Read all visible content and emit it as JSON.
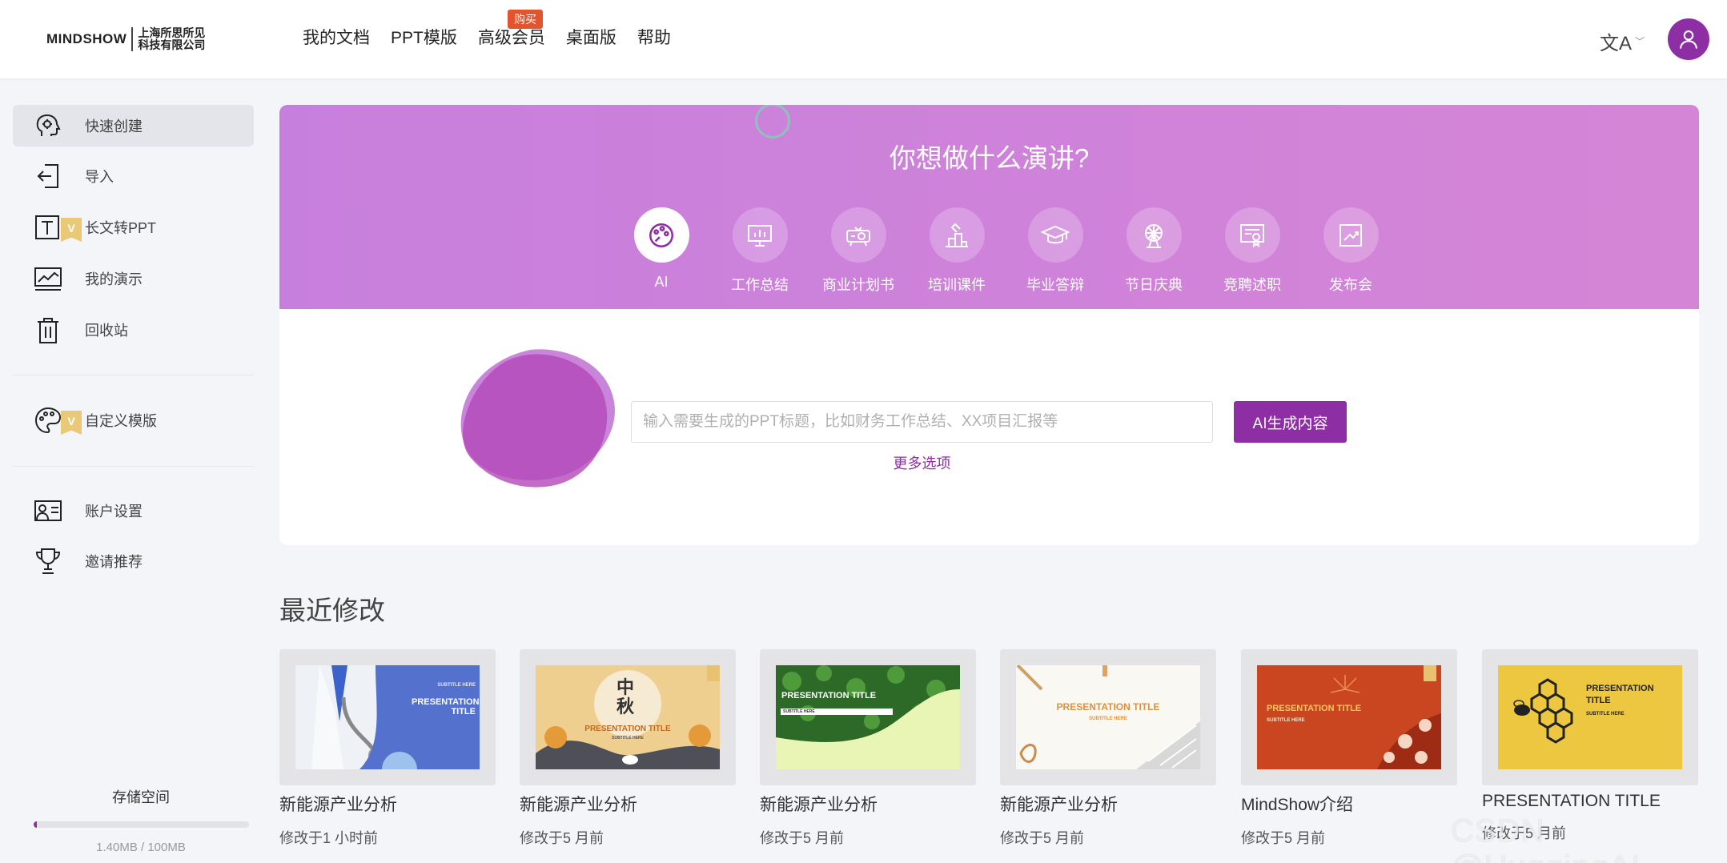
{
  "header": {
    "logo_en": "MINDSHOW",
    "logo_cn_line1": "上海所思所见",
    "logo_cn_line2": "科技有限公司",
    "nav": [
      "我的文档",
      "PPT模版",
      "高级会员",
      "桌面版",
      "帮助"
    ],
    "nav_badge": "购买",
    "lang_icon": "文A"
  },
  "sidebar": {
    "items": [
      {
        "label": "快速创建",
        "icon": "brain-head-icon"
      },
      {
        "label": "导入",
        "icon": "import-icon"
      },
      {
        "label": "长文转PPT",
        "icon": "text-icon"
      },
      {
        "label": "我的演示",
        "icon": "presentation-icon"
      },
      {
        "label": "回收站",
        "icon": "trash-icon"
      },
      {
        "label": "自定义模版",
        "icon": "palette-icon"
      },
      {
        "label": "账户设置",
        "icon": "account-icon"
      },
      {
        "label": "邀请推荐",
        "icon": "trophy-icon"
      }
    ],
    "vip_badge": "V",
    "storage_title": "存储空间",
    "storage_text": "1.40MB / 100MB",
    "storage_fraction": 0.014
  },
  "hero": {
    "title": "你想做什么演讲?",
    "categories": [
      "AI",
      "工作总结",
      "商业计划书",
      "培训课件",
      "毕业答辩",
      "节日庆典",
      "竞聘述职",
      "发布会"
    ],
    "input_placeholder": "输入需要生成的PPT标题，比如财务工作总结、XX项目汇报等",
    "ai_button": "AI生成内容",
    "more_options": "更多选项"
  },
  "recent": {
    "title": "最近修改",
    "cards": [
      {
        "name": "新能源产业分析",
        "time": "修改于1 小时前",
        "thumb_title": "PRESENTATION TITLE",
        "thumb_sub": "SUBTITLE HERE"
      },
      {
        "name": "新能源产业分析",
        "time": "修改于5 月前",
        "thumb_title": "PRESENTATION TITLE",
        "thumb_sub": "SUBTITLE HERE",
        "thumb_cn": "中秋"
      },
      {
        "name": "新能源产业分析",
        "time": "修改于5 月前",
        "thumb_title": "PRESENTATION TITLE",
        "thumb_sub": "SUBTITLE HERE"
      },
      {
        "name": "新能源产业分析",
        "time": "修改于5 月前",
        "thumb_title": "PRESENTATION TITLE",
        "thumb_sub": "SUBTITLE HERE"
      },
      {
        "name": "MindShow介绍",
        "time": "修改于5 月前",
        "thumb_title": "PRESENTATION TITLE",
        "thumb_sub": "SUBTITLE HERE"
      },
      {
        "name": "PRESENTATION TITLE",
        "time": "修改于5 月前",
        "thumb_title": "PRESENTATION TITLE",
        "thumb_sub": "SUBTITLE HERE"
      }
    ]
  },
  "watermark": "CSDN @HuggingAI",
  "colors": {
    "accent": "#8e2ea5",
    "hero_bg": "#cd84da",
    "badge": "#e2532e"
  }
}
